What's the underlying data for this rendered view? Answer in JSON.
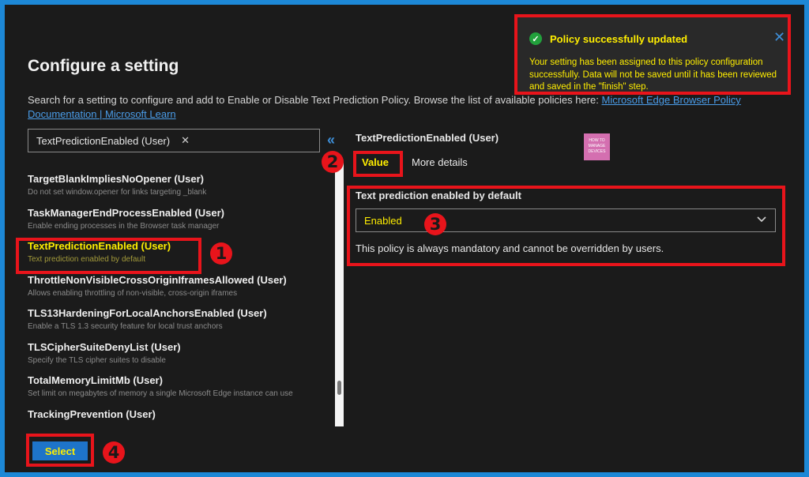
{
  "page": {
    "title": "Configure a setting",
    "description": "Search for a setting to configure and add to Enable or Disable Text Prediction Policy. Browse the list of available policies here:",
    "link_text": "Microsoft Edge Browser Policy Documentation | Microsoft Learn"
  },
  "search": {
    "value": "TextPredictionEnabled (User)",
    "clear_icon": "✕"
  },
  "collapse_icon": "«",
  "settings_list": [
    {
      "name": "TargetBlankImpliesNoOpener (User)",
      "desc": "Do not set window.opener for links targeting _blank"
    },
    {
      "name": "TaskManagerEndProcessEnabled (User)",
      "desc": "Enable ending processes in the Browser task manager"
    },
    {
      "name": "TextPredictionEnabled (User)",
      "desc": "Text prediction enabled by default"
    },
    {
      "name": "ThrottleNonVisibleCrossOriginIframesAllowed (User)",
      "desc": "Allows enabling throttling of non-visible, cross-origin iframes"
    },
    {
      "name": "TLS13HardeningForLocalAnchorsEnabled (User)",
      "desc": "Enable a TLS 1.3 security feature for local trust anchors"
    },
    {
      "name": "TLSCipherSuiteDenyList (User)",
      "desc": "Specify the TLS cipher suites to disable"
    },
    {
      "name": "TotalMemoryLimitMb (User)",
      "desc": "Set limit on megabytes of memory a single Microsoft Edge instance can use"
    },
    {
      "name": "TrackingPrevention (User)",
      "desc": ""
    }
  ],
  "detail": {
    "title": "TextPredictionEnabled (User)",
    "tabs": {
      "value": "Value",
      "more": "More details"
    },
    "field_label": "Text prediction enabled by default",
    "dropdown_value": "Enabled",
    "dropdown_icon": "⌄",
    "note": "This policy is always mandatory and cannot be overridden by users."
  },
  "logo": {
    "line1": "HOW TO",
    "line2": "MANAGE",
    "line3": "DEVICES"
  },
  "select_label": "Select",
  "toast": {
    "title": "Policy successfully updated",
    "check_icon": "✓",
    "close_icon": "✕",
    "body": "Your setting has been assigned to this policy configuration successfully. Data will not be saved until it has been reviewed and saved in the \"finish\" step."
  },
  "badges": [
    "1",
    "2",
    "3",
    "4"
  ],
  "colors": {
    "highlight": "#ffee00",
    "annotation": "#e8141b",
    "accent": "#1e74c9"
  }
}
